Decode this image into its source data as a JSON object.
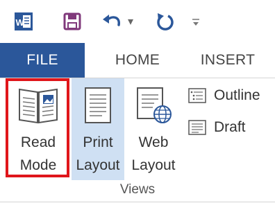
{
  "quick_access": {
    "icons": [
      "word-icon",
      "save-icon",
      "undo-icon",
      "redo-icon",
      "customize-icon"
    ],
    "undo_dropdown": "▾"
  },
  "tabs": [
    {
      "label": "FILE",
      "active": true
    },
    {
      "label": "HOME",
      "active": false
    },
    {
      "label": "INSERT",
      "active": false
    }
  ],
  "views_group": {
    "read_mode": {
      "line1": "Read",
      "line2": "Mode"
    },
    "print_layout": {
      "line1": "Print",
      "line2": "Layout"
    },
    "web_layout": {
      "line1": "Web",
      "line2": "Layout"
    },
    "outline": "Outline",
    "draft": "Draft",
    "group_label": "Views"
  },
  "colors": {
    "file_tab": "#2b579a",
    "highlight_border": "#e0161b",
    "print_layout_selected": "#cfe0f3",
    "word_blue": "#2b579a",
    "save_purple": "#80397b"
  }
}
